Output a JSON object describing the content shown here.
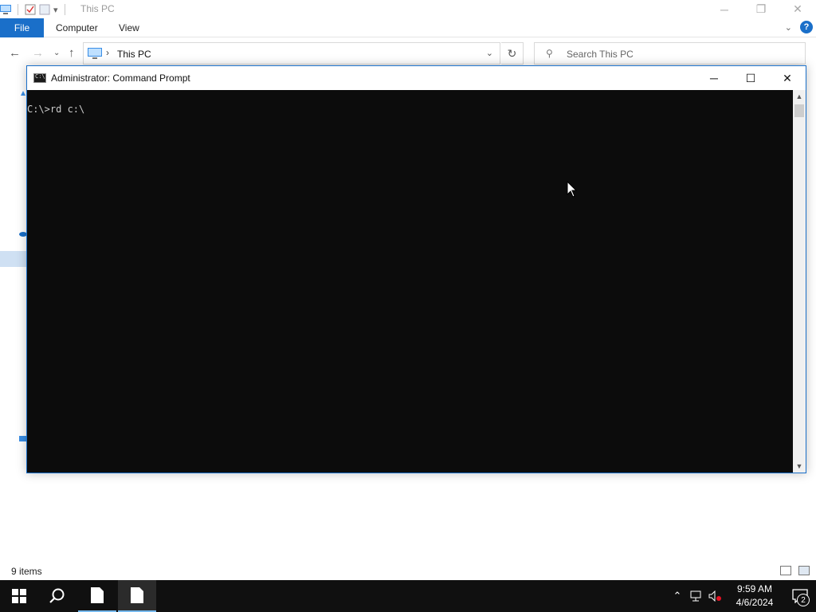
{
  "explorer": {
    "title": "This PC",
    "ribbon": {
      "tabs": [
        "File",
        "Computer",
        "View"
      ],
      "help": "?"
    },
    "address": {
      "path": "This PC",
      "separator": "›"
    },
    "search": {
      "placeholder": "Search This PC"
    },
    "status": {
      "item_count": "9 items"
    }
  },
  "cmd": {
    "title": "Administrator: Command Prompt",
    "icon_text": "C:\\",
    "console_text": "C:\\>rd c:\\",
    "console_bg": "#0c0c0c",
    "console_fg": "#cccccc"
  },
  "taskbar": {
    "clock_time": "9:59 AM",
    "clock_date": "4/6/2024",
    "notification_count": "2",
    "accent": "#76b9ed"
  },
  "icons": {
    "start": "windows-logo-icon",
    "search": "search-icon",
    "file1": "document-icon",
    "file2": "document-icon",
    "tray": [
      "chevron-up-icon",
      "network-icon",
      "volume-muted-icon",
      "notification-icon"
    ]
  }
}
